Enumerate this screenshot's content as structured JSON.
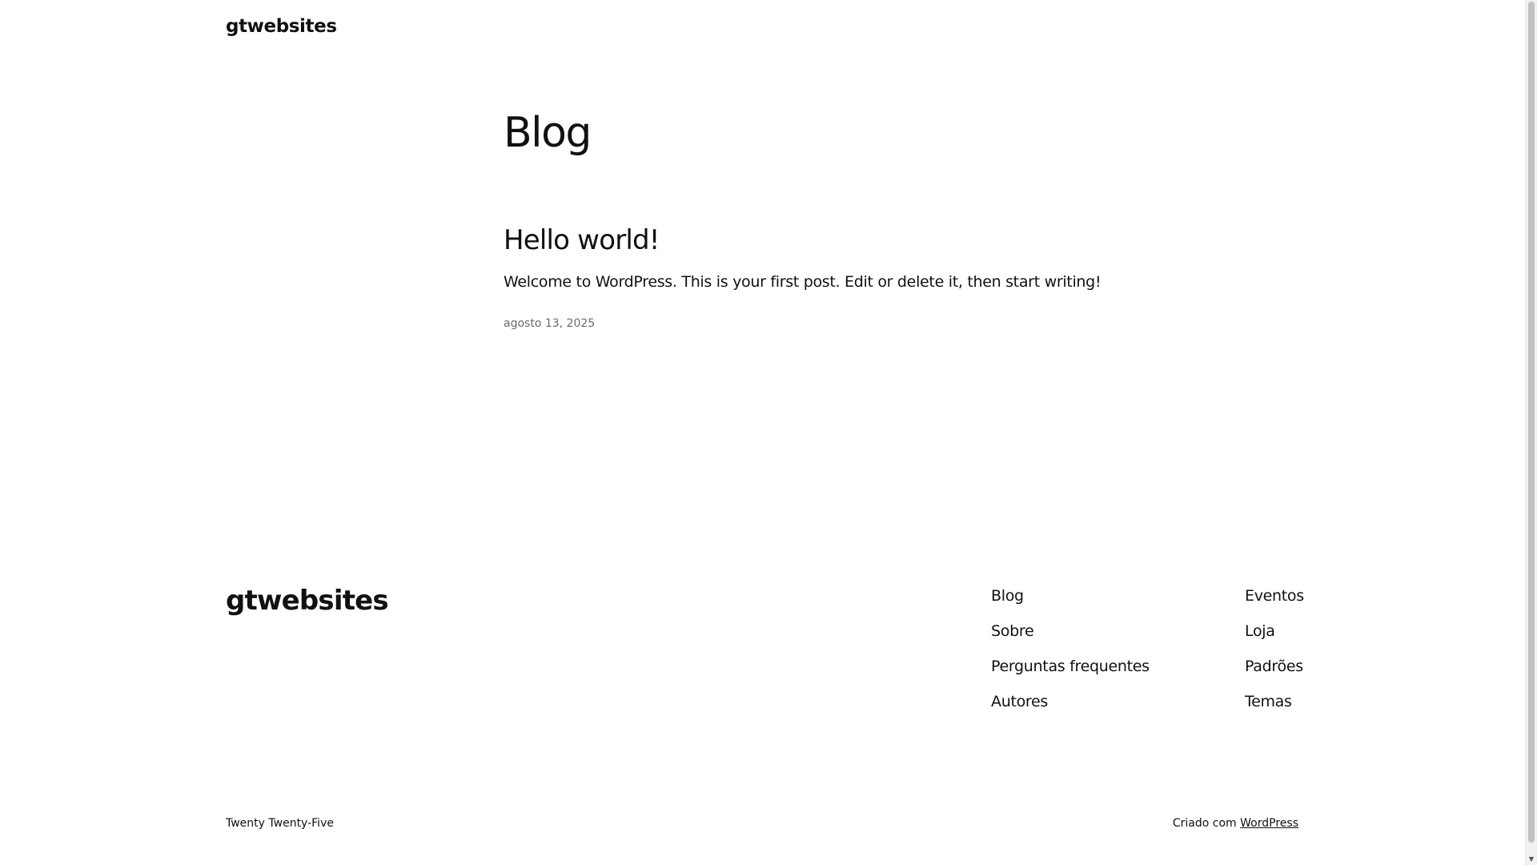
{
  "header": {
    "site_title": "gtwebsites"
  },
  "main": {
    "heading": "Blog",
    "posts": [
      {
        "title": "Hello world!",
        "excerpt": "Welcome to WordPress. This is your first post. Edit or delete it, then start writing!",
        "date": "agosto 13, 2025"
      }
    ]
  },
  "footer": {
    "site_title": "gtwebsites",
    "nav_col1": [
      "Blog",
      "Sobre",
      "Perguntas frequentes",
      "Autores"
    ],
    "nav_col2": [
      "Eventos",
      "Loja",
      "Padrões",
      "Temas"
    ],
    "theme_name": "Twenty Twenty-Five",
    "credit_prefix": "Criado com",
    "credit_link": "WordPress"
  },
  "scrollbar": {
    "arrow_icon": "chevron-down-icon"
  }
}
